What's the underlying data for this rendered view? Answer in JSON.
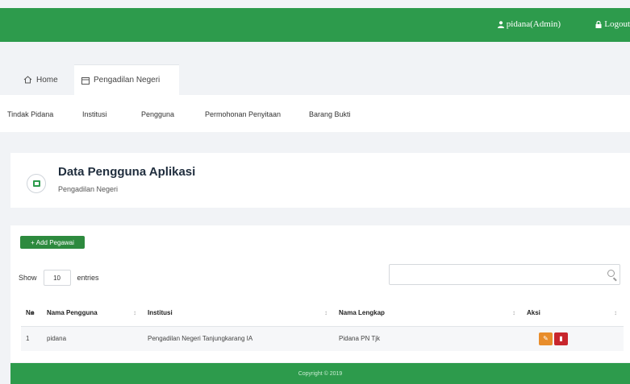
{
  "topbar": {
    "user_label": "pidana(Admin)",
    "logout_label": "Logout",
    "brand_color": "#2d9b4c"
  },
  "tabs": [
    {
      "label": "Home",
      "icon": "home-icon"
    },
    {
      "label": "Pengadilan Negeri",
      "icon": "calendar-icon",
      "active": true
    }
  ],
  "menu": [
    {
      "label": "Tindak Pidana"
    },
    {
      "label": "Institusi"
    },
    {
      "label": "Pengguna"
    },
    {
      "label": "Permohonan Penyitaan"
    },
    {
      "label": "Barang Bukti"
    }
  ],
  "header": {
    "title": "Data Pengguna Aplikasi",
    "subtitle": "Pengadilan Negeri"
  },
  "add_button": {
    "label": "Add Pegawai"
  },
  "show": {
    "prefix": "Show",
    "value": "10",
    "suffix": "entries"
  },
  "search": {
    "placeholder": ""
  },
  "table": {
    "headers": [
      "No",
      "Nama Pengguna",
      "Institusi",
      "Nama Lengkap",
      "Aksi"
    ],
    "rows": [
      {
        "no": "1",
        "username": "pidana",
        "institusi": "Pengadilan Negeri Tanjungkarang IA",
        "nama_lengkap": "Pidana PN Tjk"
      }
    ]
  },
  "footer": {
    "text": "Copyright © 2019"
  }
}
